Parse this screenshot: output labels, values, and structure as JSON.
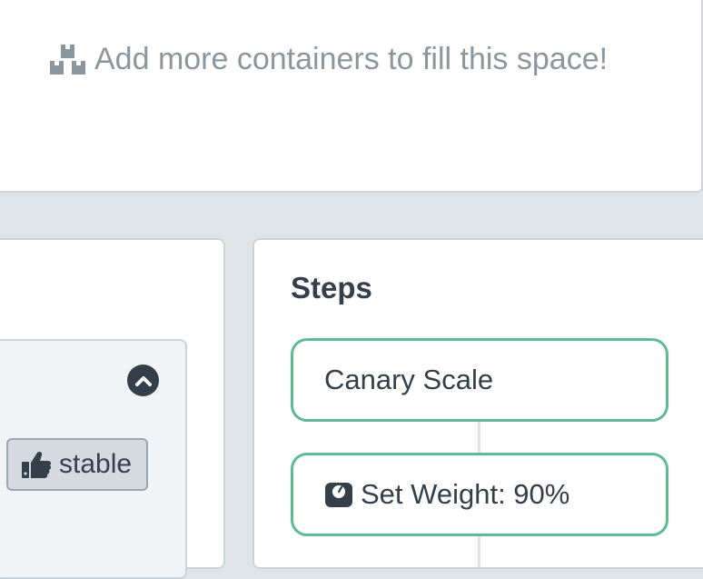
{
  "placeholder": {
    "icon": "boxes-icon",
    "text": "Add more containers to fill this space!"
  },
  "rollout_card": {
    "collapse_icon": "chevron-up-icon",
    "tag": {
      "icon": "thumbs-up-icon",
      "label": "stable"
    }
  },
  "steps_panel": {
    "title": "Steps",
    "steps": [
      {
        "label": "Canary Scale"
      },
      {
        "icon": "weight-scale-icon",
        "label": "Set Weight: 90%"
      }
    ]
  },
  "colors": {
    "background": "#dee4e7",
    "panel": "#ffffff",
    "placeholder_text": "#8b979e",
    "text": "#343f4a",
    "step_border": "#5fb995",
    "tag_background": "#d4dadf"
  }
}
